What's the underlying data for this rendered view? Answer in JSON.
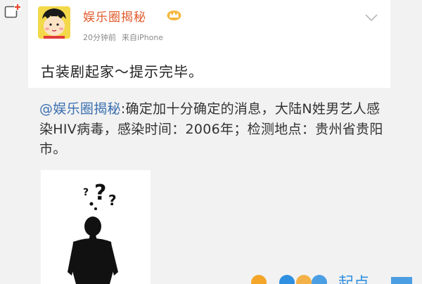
{
  "window": {
    "corner_icon": "add-square-icon"
  },
  "post": {
    "username": "娱乐圈揭秘",
    "verified_icon": "crown-badge-icon",
    "time": "20分钟前",
    "source": "来自iPhone",
    "text": "古装剧起家～提示完毕。",
    "more_icon": "chevron-down-icon"
  },
  "repost": {
    "mention": "@娱乐圈揭秘",
    "text": ":确定加十分确定的消息，大陆N姓男艺人感染HIV病毒，感染时间：2006年；检测地点：贵州省贵阳市。",
    "image_icon": "question-silhouette-image"
  },
  "watermark": {
    "text": "起点"
  },
  "colors": {
    "accent_orange": "#e05a2a",
    "link_blue": "#3a6fb0",
    "bg_gray": "#f2f2f2"
  }
}
